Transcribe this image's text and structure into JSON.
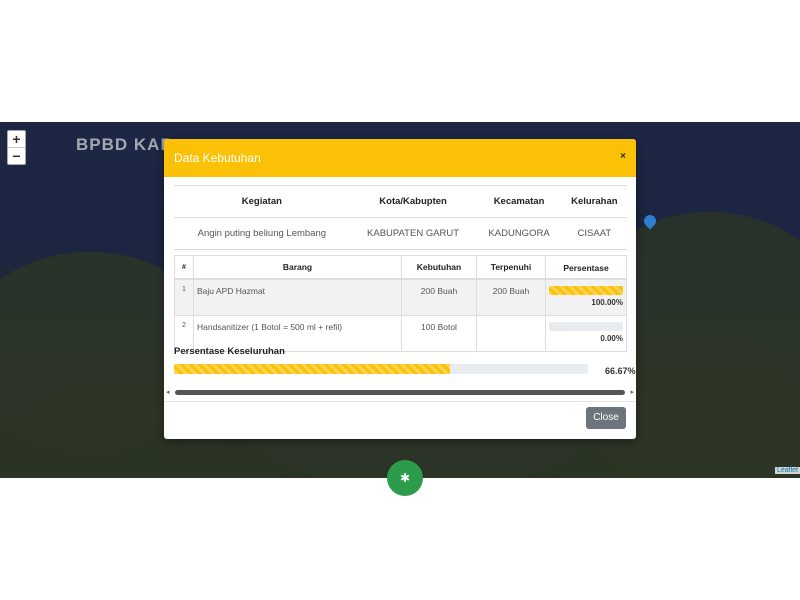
{
  "map": {
    "title": "BPBD KAB",
    "zoom_in": "+",
    "zoom_out": "−",
    "attribution": "Leaflet",
    "fab_icon": "✱"
  },
  "modal": {
    "title": "Data Kebutuhan",
    "close_x": "×",
    "event_table": {
      "headers": [
        "Kegiatan",
        "Kota/Kabupten",
        "Kecamatan",
        "Kelurahan"
      ],
      "row": [
        "Angin puting beliung Lembang",
        "KABUPATEN GARUT",
        "KADUNGORA",
        "CISAAT"
      ]
    },
    "items_table": {
      "headers": [
        "#",
        "Barang",
        "Kebutuhan",
        "Terpenuhi",
        "Persentase"
      ],
      "rows": [
        {
          "num": "1",
          "goods": "Baju APD Hazmat",
          "need": "200 Buah",
          "met": "200 Buah",
          "pct_label": "100.00%",
          "pct": 100
        },
        {
          "num": "2",
          "goods": "Handsanitizer (1 Botol = 500 ml + refil)",
          "need": "100 Botol",
          "met": "",
          "pct_label": "0.00%",
          "pct": 0
        }
      ]
    },
    "overall_label": "Persentase Keseluruhan",
    "overall_pct_label": "66.67%",
    "overall_pct": 66.67,
    "close_button": "Close"
  },
  "colors": {
    "accent": "#fbc107",
    "close_button": "#6c757d"
  }
}
